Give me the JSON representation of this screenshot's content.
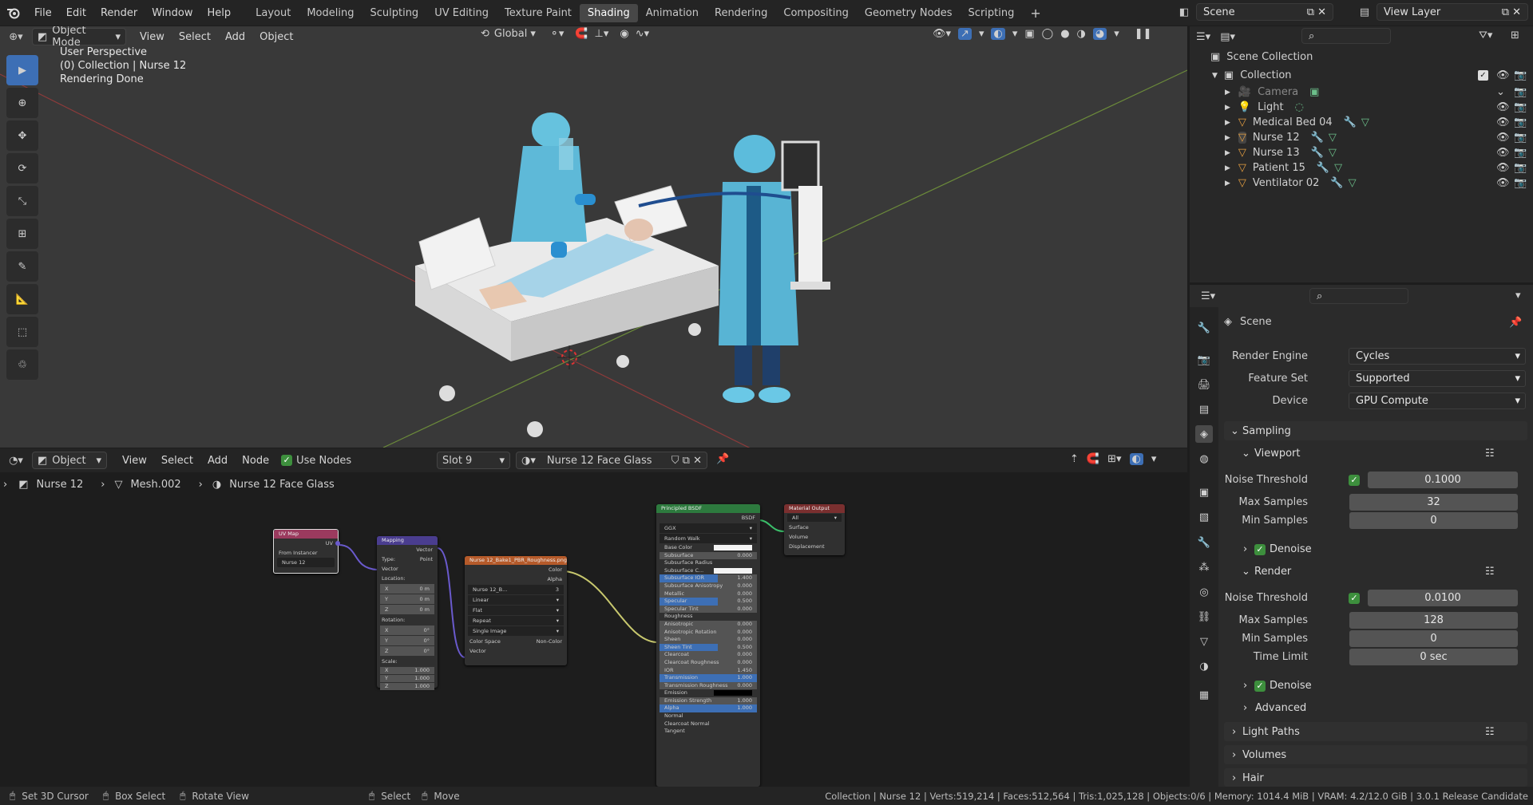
{
  "topbar": {
    "menus": [
      "File",
      "Edit",
      "Render",
      "Window",
      "Help"
    ],
    "workspaces": [
      "Layout",
      "Modeling",
      "Sculpting",
      "UV Editing",
      "Texture Paint",
      "Shading",
      "Animation",
      "Rendering",
      "Compositing",
      "Geometry Nodes",
      "Scripting"
    ],
    "active_workspace": "Shading",
    "add_tab": "+",
    "scene": "Scene",
    "view_layer": "View Layer"
  },
  "viewport": {
    "mode": "Object Mode",
    "menus": [
      "View",
      "Select",
      "Add",
      "Object"
    ],
    "transform": "Global",
    "info_line1": "User Perspective",
    "info_line2": "(0) Collection | Nurse 12",
    "info_line3": "Rendering Done"
  },
  "node_editor": {
    "type": "Object",
    "menus": [
      "View",
      "Select",
      "Add",
      "Node"
    ],
    "use_nodes": "Use Nodes",
    "slot": "Slot 9",
    "material": "Nurse 12 Face Glass",
    "breadcrumb": [
      "Nurse 12",
      "Mesh.002",
      "Nurse 12 Face Glass"
    ],
    "nodes": {
      "uvmap": {
        "title": "UV Map",
        "out": "UV",
        "from_instancer": "From Instancer",
        "map": "Nurse 12"
      },
      "mapping": {
        "title": "Mapping",
        "out": "Vector",
        "type_label": "Type:",
        "type": "Point",
        "vector": "Vector",
        "location": "Location:",
        "rotation": "Rotation:",
        "scale": "Scale:",
        "x": "X",
        "y": "Y",
        "z": "Z",
        "loc": [
          "0 m",
          "0 m",
          "0 m"
        ],
        "rot": [
          "0°",
          "0°",
          "0°"
        ],
        "scl": [
          "1.000",
          "1.000",
          "1.000"
        ]
      },
      "image": {
        "title": "Nurse 12_Bake1_PBR_Roughness.png",
        "out_color": "Color",
        "out_alpha": "Alpha",
        "image": "Nurse 12_B...",
        "count": "3",
        "interp": "Linear",
        "proj": "Flat",
        "ext": "Repeat",
        "source": "Single Image",
        "cs_label": "Color Space",
        "cs": "Non-Color",
        "vector": "Vector"
      },
      "bsdf": {
        "title": "Principled BSDF",
        "out": "BSDF",
        "dist": "GGX",
        "sss": "Random Walk",
        "rows": [
          [
            "Base Color",
            ""
          ],
          [
            "Subsurface",
            "0.000"
          ],
          [
            "Subsurface Radius",
            ""
          ],
          [
            "Subsurface C...",
            ""
          ],
          [
            "Subsurface IOR",
            "1.400"
          ],
          [
            "Subsurface Anisotropy",
            "0.000"
          ],
          [
            "Metallic",
            "0.000"
          ],
          [
            "Specular",
            "0.500"
          ],
          [
            "Specular Tint",
            "0.000"
          ],
          [
            "Roughness",
            ""
          ],
          [
            "Anisotropic",
            "0.000"
          ],
          [
            "Anisotropic Rotation",
            "0.000"
          ],
          [
            "Sheen",
            "0.000"
          ],
          [
            "Sheen Tint",
            "0.500"
          ],
          [
            "Clearcoat",
            "0.000"
          ],
          [
            "Clearcoat Roughness",
            "0.000"
          ],
          [
            "IOR",
            "1.450"
          ],
          [
            "Transmission",
            "1.000"
          ],
          [
            "Transmission Roughness",
            "0.000"
          ],
          [
            "Emission",
            ""
          ],
          [
            "Emission Strength",
            "1.000"
          ],
          [
            "Alpha",
            "1.000"
          ],
          [
            "Normal",
            ""
          ],
          [
            "Clearcoat Normal",
            ""
          ],
          [
            "Tangent",
            ""
          ]
        ]
      },
      "output": {
        "title": "Material Output",
        "target": "All",
        "inputs": [
          "Surface",
          "Volume",
          "Displacement"
        ]
      }
    }
  },
  "outliner": {
    "root": "Scene Collection",
    "collection": "Collection",
    "items": [
      "Camera",
      "Light",
      "Medical Bed 04",
      "Nurse 12",
      "Nurse 13",
      "Patient 15",
      "Ventilator 02"
    ]
  },
  "properties": {
    "title": "Scene",
    "render_engine_label": "Render Engine",
    "render_engine": "Cycles",
    "feature_set_label": "Feature Set",
    "feature_set": "Supported",
    "device_label": "Device",
    "device": "GPU Compute",
    "sampling": "Sampling",
    "viewport": "Viewport",
    "noise_threshold_label": "Noise Threshold",
    "vp_noise": "0.1000",
    "max_samples_label": "Max Samples",
    "vp_max": "32",
    "min_samples_label": "Min Samples",
    "vp_min": "0",
    "denoise": "Denoise",
    "render": "Render",
    "r_noise": "0.0100",
    "r_max": "128",
    "r_min": "0",
    "time_limit_label": "Time Limit",
    "r_time": "0 sec",
    "advanced": "Advanced",
    "light_paths": "Light Paths",
    "volumes": "Volumes",
    "hair": "Hair"
  },
  "statusbar": {
    "items": [
      "Set 3D Cursor",
      "Box Select",
      "Rotate View",
      "Select",
      "Move"
    ],
    "stats": "Collection | Nurse 12 | Verts:519,214 | Faces:512,564 | Tris:1,025,128 | Objects:0/6 | Memory: 1014.4 MiB | VRAM: 4.2/12.0 GiB | 3.0.1 Release Candidate"
  }
}
